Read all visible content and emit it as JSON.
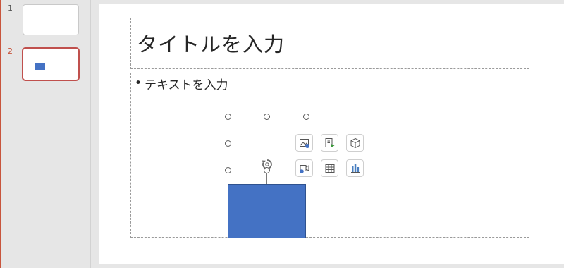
{
  "slides": [
    {
      "number": "1"
    },
    {
      "number": "2"
    }
  ],
  "title_placeholder": "タイトルを入力",
  "body": {
    "bullet": "•",
    "placeholder": "テキストを入力"
  },
  "insert_icons": [
    "insert-picture-icon",
    "insert-icons-icon",
    "insert-3d-model-icon",
    "insert-video-icon",
    "insert-table-icon",
    "insert-chart-icon"
  ],
  "colors": {
    "accent": "#c0504d",
    "shape_fill": "#4472c4",
    "shape_border": "#2f528f"
  }
}
